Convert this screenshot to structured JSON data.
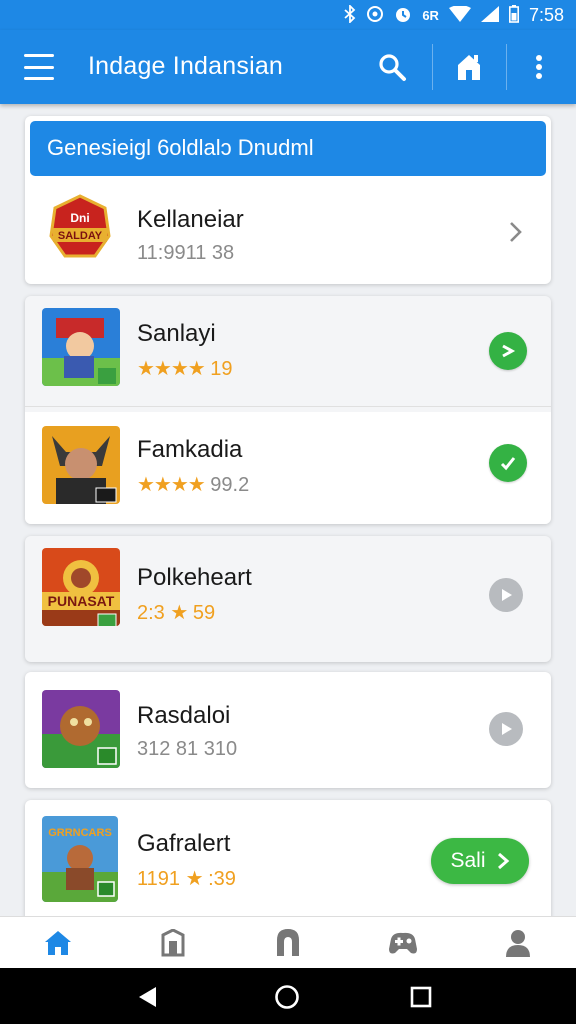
{
  "status_bar": {
    "time": "7:58",
    "signal_text": "6R"
  },
  "app_bar": {
    "title": "Indage Indansian"
  },
  "featured": {
    "header": "Genesieigl 6oldlalɔ Dnudml",
    "item": {
      "name": "Kellaneiar",
      "subtitle": "11:9911 38",
      "icon_text": "Dni SALDAY"
    }
  },
  "apps": [
    {
      "name": "Sanlayi",
      "stars": "★★★★",
      "rating": "19",
      "action": "check"
    },
    {
      "name": "Famkadia",
      "stars": "★★★★",
      "rating": "99.2",
      "action": "check"
    },
    {
      "name": "Polkeheart",
      "rating_text": "2:3",
      "star": "★",
      "rating": "59",
      "icon_text": "PUNASAT",
      "action": "play"
    },
    {
      "name": "Rasdaloi",
      "rating_text": "312 81 310",
      "action": "play"
    },
    {
      "name": "Gafralert",
      "rating_text": "1191",
      "star": "★",
      "rating": ":39",
      "icon_text": "GRRNCARS",
      "action": "button",
      "button_label": "Sali"
    }
  ],
  "colors": {
    "primary": "#1e88e5",
    "green": "#34b244",
    "star": "#f0a020",
    "gray_button": "#b8bbbf"
  },
  "bottom_nav": [
    "home-icon",
    "store-icon",
    "arch-icon",
    "gamepad-icon",
    "person-icon"
  ]
}
